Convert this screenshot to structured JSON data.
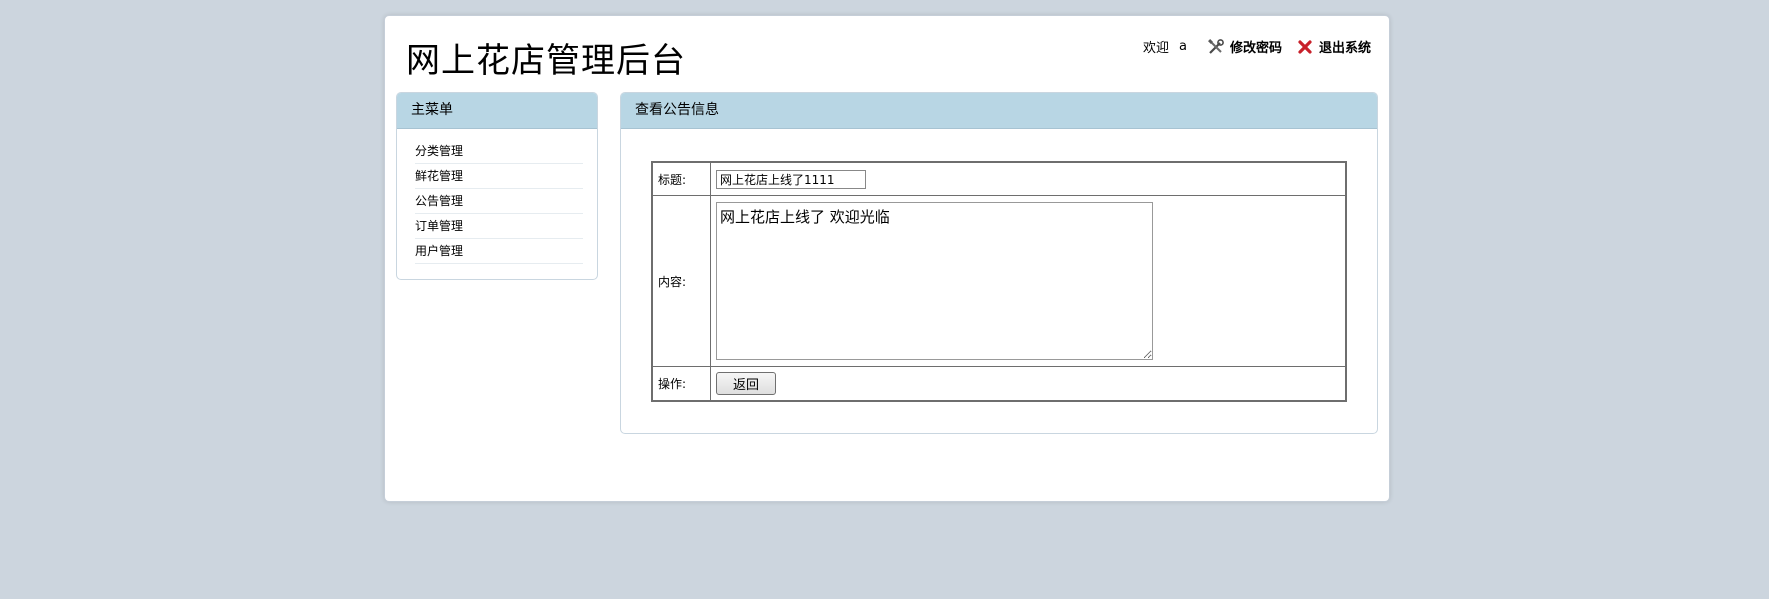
{
  "header": {
    "site_title": "网上花店管理后台",
    "welcome": "欢迎",
    "user_name": "a",
    "change_password_label": "修改密码",
    "logout_label": "退出系统"
  },
  "sidebar": {
    "heading": "主菜单",
    "items": [
      {
        "label": "分类管理"
      },
      {
        "label": "鲜花管理"
      },
      {
        "label": "公告管理"
      },
      {
        "label": "订单管理"
      },
      {
        "label": "用户管理"
      }
    ]
  },
  "main": {
    "heading": "查看公告信息",
    "form": {
      "title_label": "标题:",
      "title_value": "网上花店上线了1111",
      "content_label": "内容:",
      "content_value": "网上花店上线了 欢迎光临",
      "action_label": "操作:",
      "back_button": "返回"
    }
  },
  "colors": {
    "page_background": "#ccd5de",
    "panel_header": "#b8d6e4",
    "logout_icon": "#c8202a"
  },
  "icons": {
    "change_password": "tools-icon",
    "logout": "close-icon"
  }
}
